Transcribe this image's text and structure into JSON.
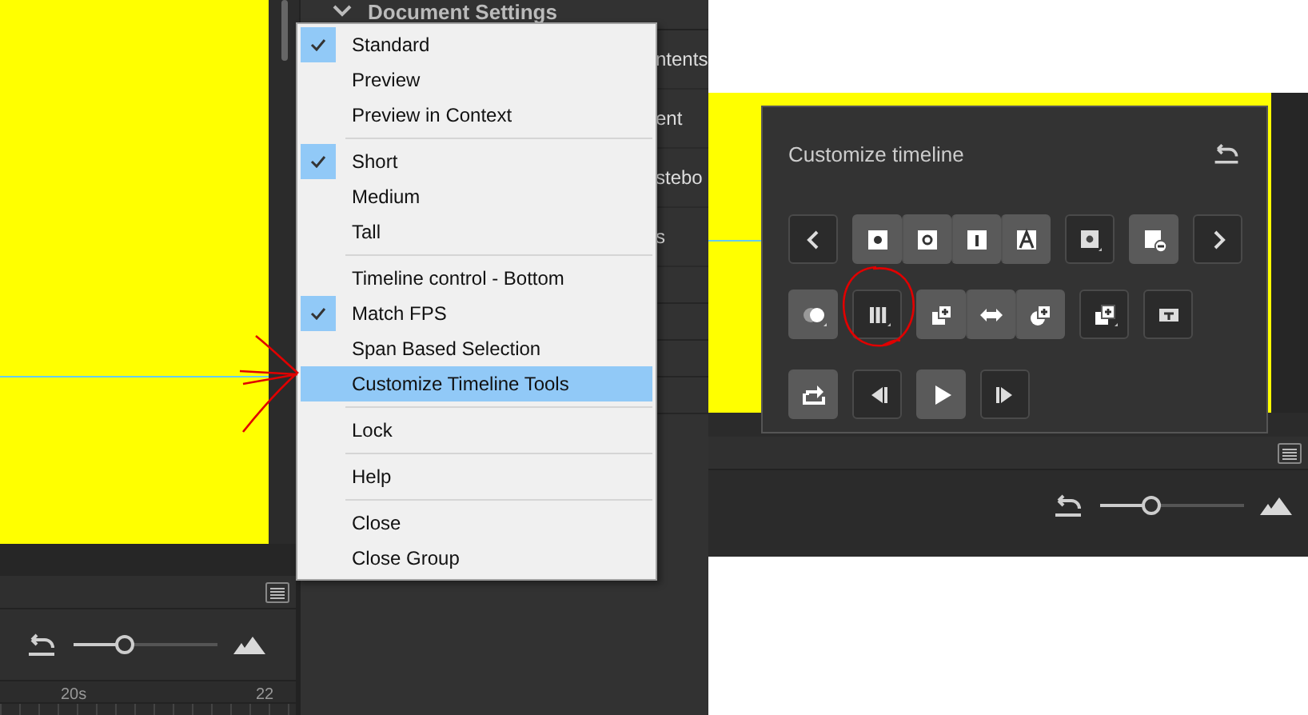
{
  "left_view": {
    "properties_panel": {
      "section_title": "Document Settings",
      "fragments": [
        "ntents",
        "ent",
        "stebo",
        "s"
      ]
    },
    "context_menu": {
      "groups": [
        [
          {
            "label": "Standard",
            "checked": true,
            "selected": false
          },
          {
            "label": "Preview",
            "checked": false,
            "selected": false
          },
          {
            "label": "Preview in Context",
            "checked": false,
            "selected": false
          }
        ],
        [
          {
            "label": "Short",
            "checked": true,
            "selected": false
          },
          {
            "label": "Medium",
            "checked": false,
            "selected": false
          },
          {
            "label": "Tall",
            "checked": false,
            "selected": false
          }
        ],
        [
          {
            "label": "Timeline control - Bottom",
            "checked": false,
            "selected": false
          },
          {
            "label": "Match FPS",
            "checked": true,
            "selected": false
          },
          {
            "label": "Span Based Selection",
            "checked": false,
            "selected": false
          },
          {
            "label": "Customize Timeline Tools",
            "checked": false,
            "selected": true
          }
        ],
        [
          {
            "label": "Lock",
            "checked": false,
            "selected": false
          }
        ],
        [
          {
            "label": "Help",
            "checked": false,
            "selected": false
          }
        ],
        [
          {
            "label": "Close",
            "checked": false,
            "selected": false
          },
          {
            "label": "Close Group",
            "checked": false,
            "selected": false
          }
        ]
      ]
    },
    "timeline": {
      "zoom_slider": {
        "level": 0.36
      },
      "ruler_labels": [
        "20s",
        "22"
      ]
    }
  },
  "right_view": {
    "customize_panel": {
      "title": "Customize timeline",
      "rows": [
        [
          [
            {
              "kind": "prev",
              "on": false
            }
          ],
          [
            {
              "kind": "keyframe",
              "on": true
            },
            {
              "kind": "blank-keyframe",
              "on": true
            },
            {
              "kind": "frame",
              "on": true
            },
            {
              "kind": "text",
              "on": true
            }
          ],
          [
            {
              "kind": "keyframe-menu",
              "on": false
            }
          ],
          [
            {
              "kind": "remove-frame",
              "on": true
            }
          ],
          [
            {
              "kind": "next",
              "on": false
            }
          ]
        ],
        [
          [
            {
              "kind": "onion",
              "on": true
            }
          ],
          [
            {
              "kind": "frames",
              "on": false
            }
          ],
          [
            {
              "kind": "copy",
              "on": true
            },
            {
              "kind": "swap",
              "on": true
            },
            {
              "kind": "shape-copy",
              "on": true
            }
          ],
          [
            {
              "kind": "copy-menu",
              "on": false
            }
          ],
          [
            {
              "kind": "parent",
              "on": false
            }
          ]
        ],
        [
          [
            {
              "kind": "loop",
              "on": true
            }
          ],
          [
            {
              "kind": "step-back",
              "on": false
            }
          ],
          [
            {
              "kind": "play",
              "on": true
            }
          ],
          [
            {
              "kind": "step-forward",
              "on": false
            }
          ]
        ]
      ]
    },
    "timeline": {
      "zoom_slider": {
        "level": 0.35
      }
    }
  }
}
